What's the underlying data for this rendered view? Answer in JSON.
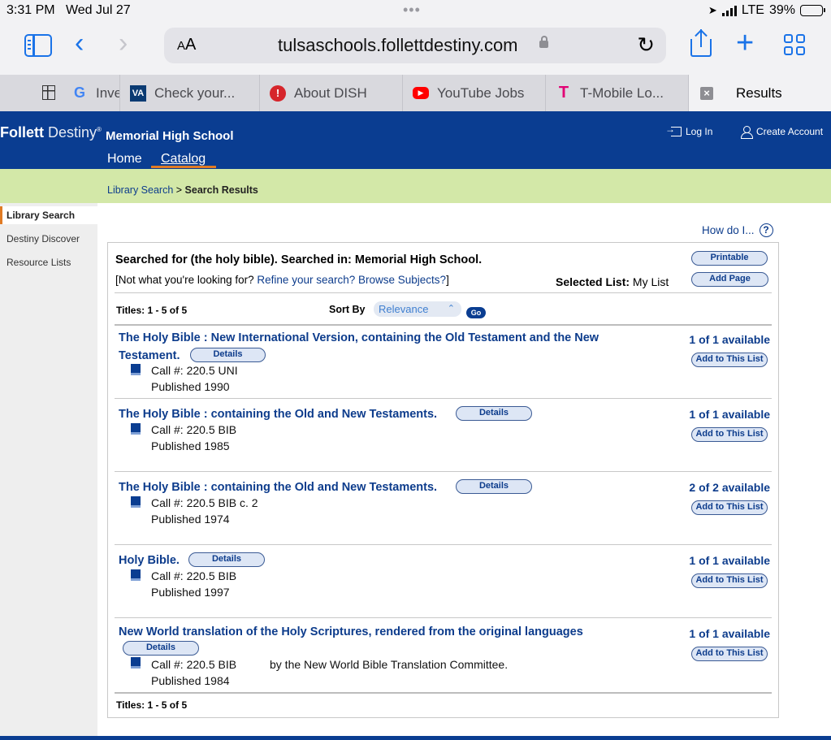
{
  "status": {
    "time": "3:31 PM",
    "date": "Wed Jul 27",
    "dots": "•••",
    "network": "LTE",
    "battery": "39%",
    "battery_level": 0.39
  },
  "safari": {
    "text_size": "AA",
    "url": "tulsaschools.follettdestiny.com",
    "tabs": [
      {
        "label": "Inve",
        "icon": "google-icon"
      },
      {
        "label": "Check your...",
        "icon": "va-icon"
      },
      {
        "label": "About DISH",
        "icon": "dish-icon"
      },
      {
        "label": "YouTube Jobs",
        "icon": "youtube-icon"
      },
      {
        "label": "T-Mobile Lo...",
        "icon": "tmobile-icon"
      },
      {
        "label": "Results",
        "icon": "close-icon"
      }
    ]
  },
  "header": {
    "brand_bold": "Follett",
    "brand_light": " Destiny",
    "brand_mark": "®",
    "school": "Memorial High School",
    "nav_home": "Home",
    "nav_catalog": "Catalog",
    "login": "Log In",
    "create_account": "Create Account"
  },
  "breadcrumb": {
    "link": "Library Search",
    "sep": " > ",
    "current": "Search Results"
  },
  "sidebar": {
    "items": [
      "Library Search",
      "Destiny Discover",
      "Resource Lists"
    ]
  },
  "content": {
    "how_do_i": "How do I...",
    "searched": "Searched for (the holy bible). Searched in: Memorial High School.",
    "not_what_open": "[Not what you're looking for? ",
    "refine": "Refine your search?",
    "browse": "Browse Subjects?",
    "not_what_close": "]",
    "selected_label": "Selected List:",
    "selected_value": " My List",
    "printable": "Printable",
    "add_page": "Add Page",
    "titles_count": "Titles: 1 - 5 of 5",
    "sort_by": "Sort By",
    "sort_value": "Relevance",
    "go": "Go",
    "details": "Details",
    "add_to_list": "Add to This List"
  },
  "results": [
    {
      "title_1": "The Holy Bible : New International Version, containing the Old Testament and the New",
      "title_2": "Testament.",
      "call": "Call #: 220.5 UNI",
      "published": "Published 1990",
      "availability": "1 of 1 available"
    },
    {
      "title_1": "The Holy Bible : containing the Old and New Testaments.",
      "call": "Call #: 220.5 BIB",
      "published": "Published 1985",
      "availability": "1 of 1 available"
    },
    {
      "title_1": "The Holy Bible : containing the Old and New Testaments.",
      "call": "Call #: 220.5 BIB c. 2",
      "published": "Published 1974",
      "availability": "2 of 2 available"
    },
    {
      "title_1": "Holy Bible.",
      "call": "Call #: 220.5 BIB",
      "published": "Published 1997",
      "availability": "1 of 1 available"
    },
    {
      "title_1": "New World translation of the Holy Scriptures, rendered from the original languages",
      "call": "Call #: 220.5 BIB",
      "author": "by the New World Bible Translation Committee.",
      "published": "Published 1984",
      "availability": "1 of 1 available"
    }
  ]
}
